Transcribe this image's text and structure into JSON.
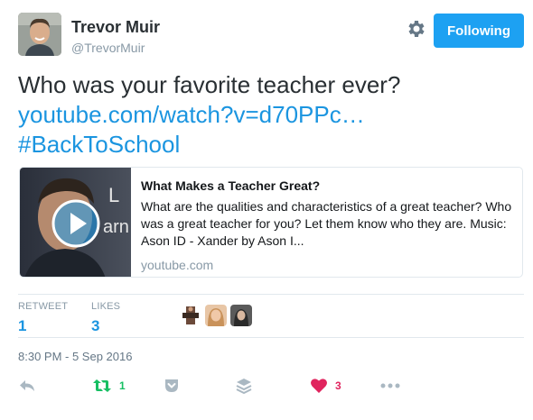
{
  "author": {
    "name": "Trevor Muir",
    "handle": "@TrevorMuir"
  },
  "follow_button": {
    "label": "Following"
  },
  "tweet": {
    "text": "Who was your favorite teacher ever?",
    "link": "youtube.com/watch?v=d70PPc…",
    "hashtag": "#BackToSchool"
  },
  "card": {
    "title": "What Makes a Teacher Great?",
    "description": "What are the qualities and characteristics of a great teacher? Who was a great teacher for you? Let them know who they are. Music: Ason ID - Xander by Ason I...",
    "domain": "youtube.com",
    "thumb_overlay_text": "L​eArn"
  },
  "stats": {
    "retweets_label": "RETWEET",
    "retweets_value": "1",
    "likes_label": "LIKES",
    "likes_value": "3"
  },
  "timestamp": "8:30 PM - 5 Sep 2016",
  "actions": {
    "retweet_count": "1",
    "like_count": "3"
  },
  "colors": {
    "accent": "#1da1f2",
    "link": "#1b95e0",
    "retweet": "#17bf63",
    "like": "#e0245e",
    "muted": "#8899a6"
  }
}
